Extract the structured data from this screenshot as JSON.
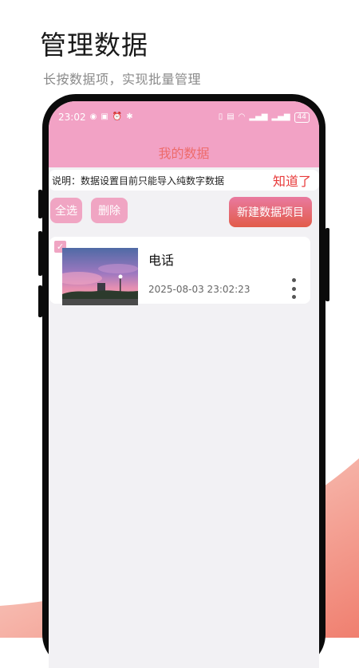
{
  "promo": {
    "title": "管理数据",
    "subtitle": "长按数据项，实现批量管理"
  },
  "status_bar": {
    "time": "23:02",
    "battery": "44"
  },
  "app": {
    "title": "我的数据",
    "accent_color": "#f2a2c5",
    "title_color": "#ee6b6b"
  },
  "notice": {
    "text": "说明：数据设置目前只能导入纯数字数据",
    "dismiss_label": "知道了"
  },
  "toolbar": {
    "select_all_label": "全选",
    "delete_label": "删除",
    "new_item_label": "新建数据项目"
  },
  "items": [
    {
      "title": "电话",
      "timestamp": "2025-08-03 23:02:23",
      "checked": true
    }
  ]
}
